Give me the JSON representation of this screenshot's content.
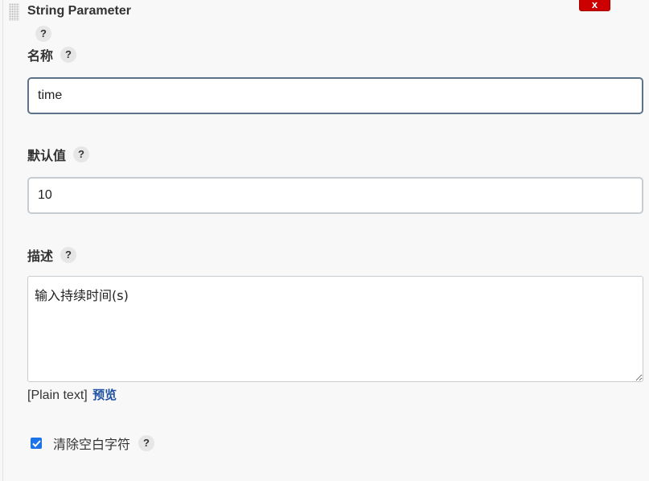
{
  "section": {
    "title": "String Parameter",
    "delete_label": "x",
    "help": "?"
  },
  "fields": {
    "name": {
      "label": "名称",
      "help": "?",
      "value": "time"
    },
    "default": {
      "label": "默认值",
      "help": "?",
      "value": "10"
    },
    "description": {
      "label": "描述",
      "help": "?",
      "value": "输入持续时间(s)"
    }
  },
  "markup": {
    "format": "[Plain text]",
    "preview_link": "预览"
  },
  "trim": {
    "label": "清除空白字符",
    "help": "?",
    "checked": true
  },
  "colors": {
    "delete": "#cc0000",
    "link": "#1d4fa0",
    "checkbox": "#1a73e8",
    "focus_border": "#5c7389"
  }
}
